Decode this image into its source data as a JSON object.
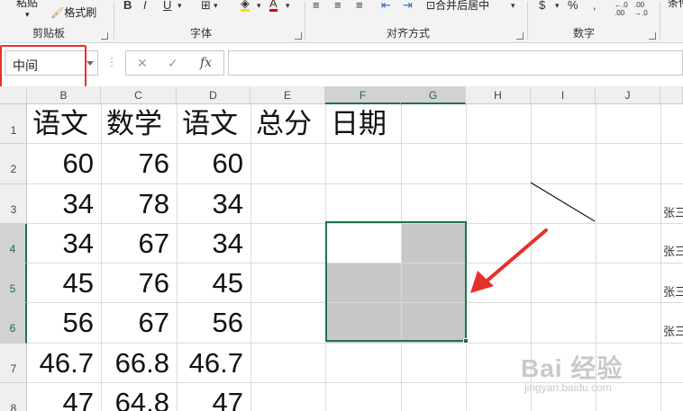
{
  "ribbon": {
    "clipboard": {
      "paste_label": "粘贴",
      "format_painter": "格式刷",
      "group_label": "剪贴板"
    },
    "font": {
      "bold": "B",
      "italic": "I",
      "underline": "U",
      "font_color_icon": "A",
      "group_label": "字体"
    },
    "alignment": {
      "merge_center": "合并后居中",
      "group_label": "对齐方式"
    },
    "number": {
      "currency": "$",
      "percent": "%",
      "comma": ",",
      "inc_decimal": "←.0 .00",
      "dec_decimal": ".00 →.0",
      "group_label": "数字"
    },
    "next_group_label": "条件"
  },
  "formula_bar": {
    "name_box": "中间",
    "cancel_icon": "✕",
    "enter_icon": "✓",
    "fx_icon": "fx",
    "formula": ""
  },
  "grid": {
    "columns": [
      "B",
      "C",
      "D",
      "E",
      "F",
      "G",
      "H",
      "I",
      "J"
    ],
    "rows": [
      "1",
      "2",
      "3",
      "4",
      "5",
      "6",
      "7",
      "8"
    ],
    "header_row": [
      "语文",
      "数学",
      "语文",
      "总分",
      "日期"
    ],
    "data": [
      [
        "60",
        "76",
        "60"
      ],
      [
        "34",
        "78",
        "34"
      ],
      [
        "34",
        "67",
        "34"
      ],
      [
        "45",
        "76",
        "45"
      ],
      [
        "56",
        "67",
        "56"
      ],
      [
        "46.7",
        "66.8",
        "46.7"
      ],
      [
        "47",
        "64.8",
        "47"
      ]
    ],
    "side_labels": [
      "张三",
      "张三",
      "张三",
      "张三"
    ],
    "selected_range": "F4:G6"
  },
  "colors": {
    "selection": "#217346",
    "annotation": "#e8302a",
    "shaded_cell": "#c8c8c8"
  },
  "watermark": {
    "brand": "Bai 经验",
    "url": "jingyan.baidu.com"
  }
}
